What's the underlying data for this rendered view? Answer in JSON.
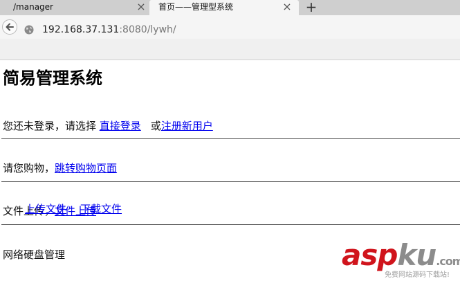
{
  "browser": {
    "tabs": [
      {
        "title": "/manager",
        "active": false
      },
      {
        "title": "首页——管理型系统",
        "active": true
      }
    ],
    "tab_close_symbol": "×",
    "new_tab_symbol": "+",
    "address": {
      "host": "192.168.37.131",
      "rest": ":8080/lywh/"
    }
  },
  "page": {
    "title": "简易管理系统",
    "login": {
      "prompt": "您还未登录，请选择 ",
      "login_link": "直接登录",
      "or": "或",
      "register_link": "注册新用户"
    },
    "shop": {
      "prompt": "请您购物，",
      "link": "跳转购物页面"
    },
    "upload": {
      "prompt": "文件上传，",
      "link": "文件上传"
    },
    "disk": {
      "heading": "网络硬盘管理",
      "upload_link": "上传文件",
      "download_link": "下载文件"
    }
  },
  "watermark": {
    "brand_red": "asp",
    "brand_gray": "ku",
    "suffix": ".com",
    "subtitle": "免费网站源码下载站!"
  },
  "colors": {
    "link": "#0000ee",
    "tabbar": "#cfcfcf",
    "active_tab": "#f5f5f5",
    "brand": "#d0141c"
  }
}
